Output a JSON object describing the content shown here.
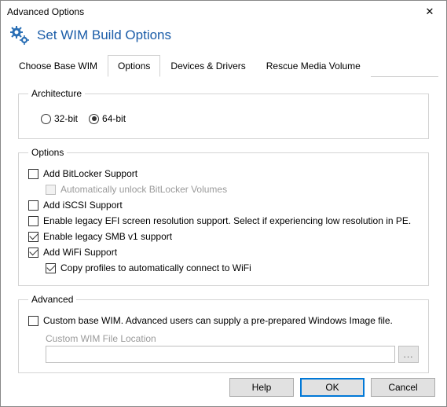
{
  "window": {
    "title": "Advanced Options"
  },
  "header": {
    "title": "Set WIM Build Options"
  },
  "tabs": [
    {
      "label": "Choose Base WIM"
    },
    {
      "label": "Options"
    },
    {
      "label": "Devices & Drivers"
    },
    {
      "label": "Rescue Media Volume"
    }
  ],
  "architecture": {
    "legend": "Architecture",
    "opt32": "32-bit",
    "opt64": "64-bit"
  },
  "options": {
    "legend": "Options",
    "bitlocker": "Add BitLocker Support",
    "bitlocker_auto": "Automatically unlock BitLocker Volumes",
    "iscsi": "Add iSCSI Support",
    "legacy_efi": "Enable legacy EFI screen resolution support.  Select if experiencing low resolution in PE.",
    "legacy_smb": "Enable legacy SMB v1 support",
    "wifi": "Add WiFi Support",
    "wifi_copy": "Copy profiles to automatically connect to WiFi"
  },
  "advanced": {
    "legend": "Advanced",
    "custom_wim": "Custom base WIM. Advanced users can supply a pre-prepared Windows Image file.",
    "location_label": "Custom WIM File Location",
    "location_value": "",
    "browse": "..."
  },
  "buttons": {
    "help": "Help",
    "ok": "OK",
    "cancel": "Cancel"
  }
}
